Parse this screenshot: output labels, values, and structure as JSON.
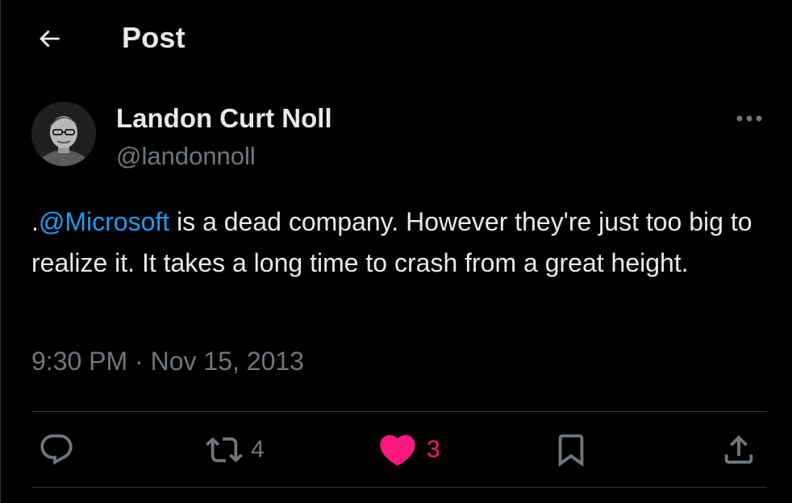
{
  "header": {
    "title": "Post"
  },
  "author": {
    "name": "Landon Curt Noll",
    "handle": "@landonnoll"
  },
  "tweet": {
    "prefix": ".",
    "mention": "@Microsoft",
    "body": " is a dead company. However they're just too big to realize it. It takes a long time to crash from a great height.",
    "time": "9:30 PM",
    "separator": " · ",
    "date": "Nov 15, 2013"
  },
  "actions": {
    "reply_icon": "reply-icon",
    "retweet_icon": "retweet-icon",
    "retweet_count": "4",
    "like_icon": "heart-icon",
    "like_count": "3",
    "bookmark_icon": "bookmark-icon",
    "share_icon": "share-icon"
  },
  "colors": {
    "background": "#000000",
    "text": "#e7e9ea",
    "muted": "#71767b",
    "link": "#1d9bf0",
    "like": "#f91880",
    "border": "#2f3336"
  }
}
